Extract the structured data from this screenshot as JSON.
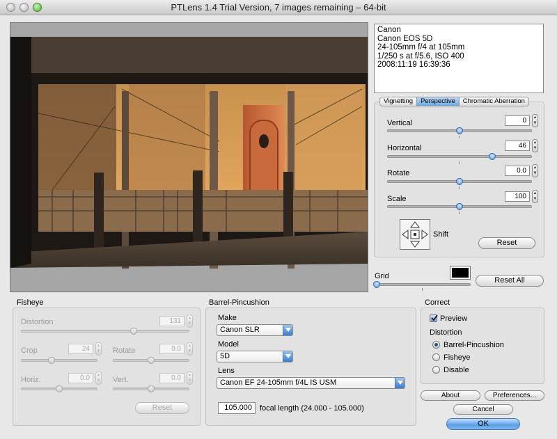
{
  "window": {
    "title": "PTLens 1.4 Trial Version, 7 images remaining – 64-bit"
  },
  "exif": [
    "Canon",
    "Canon EOS 5D",
    "24-105mm f/4 at 105mm",
    "1/250 s at f/5.6, ISO 400",
    "2008:11:19 16:39:36"
  ],
  "tabs": [
    {
      "label": "Vignetting",
      "selected": false
    },
    {
      "label": "Perspective",
      "selected": true
    },
    {
      "label": "Chromatic Aberration",
      "selected": false
    }
  ],
  "perspective": {
    "vertical": {
      "label": "Vertical",
      "value": "0",
      "slider": 0.5
    },
    "horizontal": {
      "label": "Horizontal",
      "value": "46",
      "slider": 0.73
    },
    "rotate": {
      "label": "Rotate",
      "value": "0.0",
      "slider": 0.5
    },
    "scale": {
      "label": "Scale",
      "value": "100",
      "slider": 0.5
    },
    "shift_label": "Shift",
    "reset_label": "Reset"
  },
  "grid": {
    "label": "Grid",
    "reset_all_label": "Reset All",
    "color": "#000000",
    "slider": 0.0
  },
  "fisheye": {
    "title": "Fisheye",
    "distortion": {
      "label": "Distortion",
      "value": "131",
      "slider": 0.67
    },
    "crop": {
      "label": "Crop",
      "value": "24",
      "slider": 0.4
    },
    "rotate": {
      "label": "Rotate",
      "value": "0.0",
      "slider": 0.5
    },
    "horiz": {
      "label": "Horiz.",
      "value": "0.0",
      "slider": 0.5
    },
    "vert": {
      "label": "Vert.",
      "value": "0.0",
      "slider": 0.5
    },
    "reset_label": "Reset"
  },
  "barrel": {
    "title": "Barrel-Pincushion",
    "make_label": "Make",
    "make_value": "Canon SLR",
    "model_label": "Model",
    "model_value": "5D",
    "lens_label": "Lens",
    "lens_value": "Canon EF 24-105mm f/4L IS USM",
    "focal_value": "105.000",
    "focal_text": "focal length (24.000 - 105.000)"
  },
  "correct": {
    "title": "Correct",
    "preview_label": "Preview",
    "distortion_label": "Distortion",
    "options": [
      {
        "label": "Barrel-Pincushion",
        "selected": true
      },
      {
        "label": "Fisheye",
        "selected": false
      },
      {
        "label": "Disable",
        "selected": false
      }
    ]
  },
  "buttons": {
    "about": "About",
    "preferences": "Preferences...",
    "cancel": "Cancel",
    "ok": "OK"
  },
  "colors": {
    "accent": "#5c9ee6"
  }
}
